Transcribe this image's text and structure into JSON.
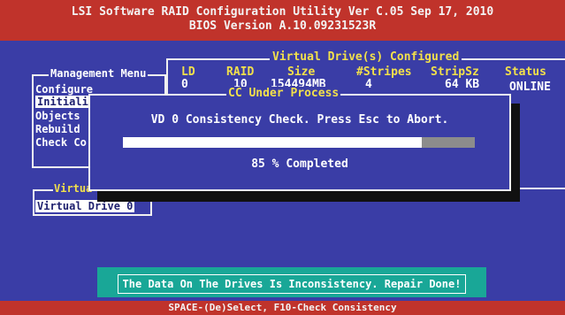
{
  "title": {
    "line1": "LSI Software RAID Configuration Utility Ver C.05 Sep 17, 2010",
    "line2": "BIOS Version   A.10.09231523R"
  },
  "vd_panel": {
    "title": "Virtual Drive(s) Configured",
    "headers": [
      "LD",
      "RAID",
      "Size",
      "#Stripes",
      "StripSz",
      "Status"
    ],
    "row": [
      "0",
      "10",
      "154494MB",
      "4",
      "64 KB",
      "ONLINE"
    ]
  },
  "management_menu": {
    "title": "Management Menu",
    "items": [
      "Configure",
      "Initiali",
      "Objects",
      "Rebuild",
      "Check Co"
    ],
    "selected_index": 1
  },
  "virtual_list": {
    "title": "Virtua",
    "item": "Virtual Drive 0"
  },
  "dialog": {
    "title": "CC Under Process",
    "message": "VD 0 Consistency Check. Press Esc to Abort.",
    "progress": 0.85,
    "progress_text": "85 % Completed"
  },
  "notice": "The Data On The Drives Is Inconsistency. Repair Done!",
  "footer": "SPACE-(De)Select,    F10-Check Consistency",
  "colors": {
    "background": "#3a3da6",
    "title_bar": "#c0332b",
    "heading": "#f2e04b",
    "notice_bg": "#19a797"
  }
}
